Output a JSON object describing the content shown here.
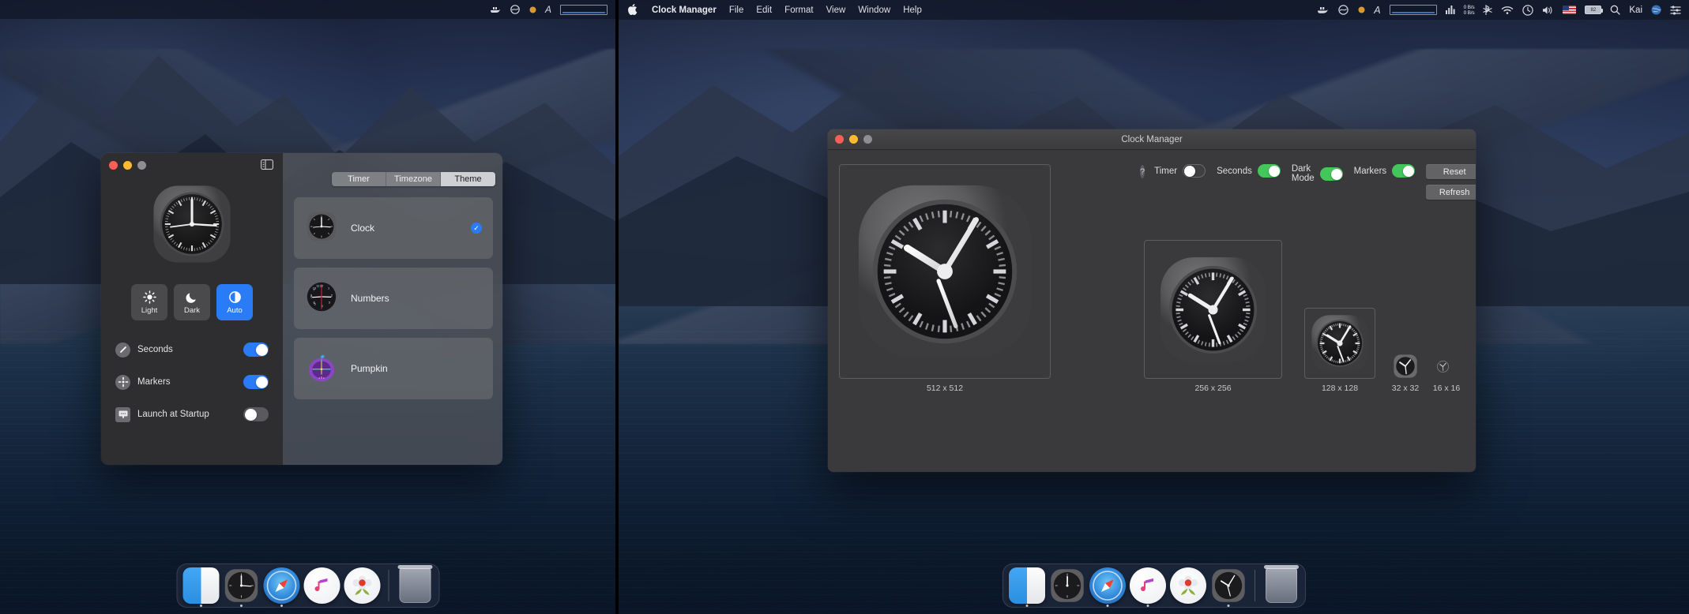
{
  "left_screen": {
    "menubar": {
      "status_icons": [
        "docker-icon",
        "cloud-sync-icon",
        "orange-dot-icon",
        "text-input-A-icon",
        "network-graph-icon"
      ]
    },
    "prefs_window": {
      "sidebar_toggle_icon": "sidebar-toggle-icon",
      "preview_clock_label": "clock-preview",
      "appearance": {
        "options": [
          {
            "label": "Light",
            "icon": "sun-icon",
            "selected": false
          },
          {
            "label": "Dark",
            "icon": "moon-icon",
            "selected": false
          },
          {
            "label": "Auto",
            "icon": "half-circle-icon",
            "selected": true
          }
        ]
      },
      "switches": [
        {
          "label": "Seconds",
          "icon": "second-hand-icon",
          "on": true
        },
        {
          "label": "Markers",
          "icon": "markers-icon",
          "on": true
        },
        {
          "label": "Launch at Startup",
          "icon": "display-icon",
          "on": false
        }
      ],
      "tabs": [
        {
          "label": "Timer",
          "selected": false
        },
        {
          "label": "Timezone",
          "selected": false
        },
        {
          "label": "Theme",
          "selected": true
        }
      ],
      "themes": [
        {
          "label": "Clock",
          "selected": true,
          "icon": "clock-theme-icon"
        },
        {
          "label": "Numbers",
          "selected": false,
          "icon": "numbers-theme-icon"
        },
        {
          "label": "Pumpkin",
          "selected": false,
          "icon": "pumpkin-theme-icon"
        }
      ],
      "check_glyph": "✓"
    },
    "dock": {
      "items": [
        {
          "name": "finder",
          "running": true
        },
        {
          "name": "clock",
          "running": true
        },
        {
          "name": "safari",
          "running": true
        },
        {
          "name": "music",
          "running": false
        },
        {
          "name": "photos",
          "running": false
        }
      ],
      "trash": "trash"
    }
  },
  "right_screen": {
    "menubar": {
      "apple_glyph": "",
      "app_name": "Clock Manager",
      "menus": [
        "File",
        "Edit",
        "Format",
        "View",
        "Window",
        "Help"
      ],
      "network_rate": "0 B/s\n0 B/s",
      "battery_text": "82",
      "user": "Kai",
      "status_icons": [
        "docker-icon",
        "cloud-sync-icon",
        "orange-dot-icon",
        "text-input-A-icon",
        "network-box-icon",
        "audio-meter-icon",
        "network-rate-icon",
        "bluetooth-icon",
        "wifi-icon",
        "time-machine-icon",
        "volume-icon",
        "flag-icon",
        "battery-icon",
        "search-icon",
        "user-icon",
        "globe-icon",
        "control-center-icon"
      ]
    },
    "window": {
      "title": "Clock Manager",
      "help_glyph": "?",
      "toggles": [
        {
          "label": "Timer",
          "on": false
        },
        {
          "label": "Seconds",
          "on": true
        },
        {
          "label": "Dark Mode",
          "on": true
        },
        {
          "label": "Markers",
          "on": true
        }
      ],
      "buttons": [
        {
          "label": "Reset"
        },
        {
          "label": "Refresh"
        }
      ],
      "previews": [
        {
          "caption": "512 x 512"
        },
        {
          "caption": "256 x 256"
        },
        {
          "caption": "128 x 128"
        },
        {
          "caption": "32 x 32"
        },
        {
          "caption": "16 x 16"
        }
      ]
    },
    "dock": {
      "items": [
        {
          "name": "finder",
          "running": true
        },
        {
          "name": "clock",
          "running": false
        },
        {
          "name": "safari",
          "running": true
        },
        {
          "name": "music",
          "running": true
        },
        {
          "name": "photos",
          "running": false
        },
        {
          "name": "clock-manager",
          "running": true
        }
      ],
      "trash": "trash"
    }
  },
  "colors": {
    "accent_blue": "#2a7bf6",
    "toggle_green": "#43c75a",
    "window_bg": "#3a3a3c",
    "prefs_bg": "#2e2e30"
  }
}
